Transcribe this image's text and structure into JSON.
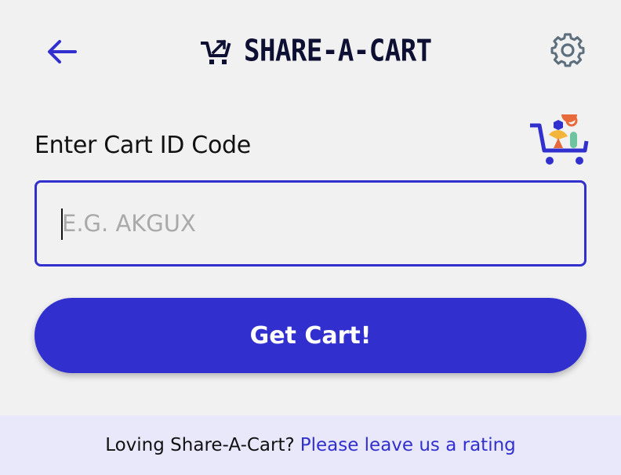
{
  "header": {
    "back_icon": "arrow-left-icon",
    "brand_icon": "cart-transfer-icon",
    "title": "SHARE-A-CART",
    "settings_icon": "gear-icon"
  },
  "form": {
    "label": "Enter Cart ID Code",
    "illustration": "shopping-cart-illustration",
    "input": {
      "value": "",
      "placeholder": "E.G. AKGUX"
    },
    "submit_label": "Get Cart!"
  },
  "footer": {
    "text": "Loving Share-A-Cart?",
    "link_text": "Please leave us a rating"
  },
  "colors": {
    "accent": "#3130cf",
    "background": "#f1f1f1",
    "footer_bg": "#e9e8fb",
    "title": "#0e1033",
    "gear": "#5d6e7d"
  }
}
